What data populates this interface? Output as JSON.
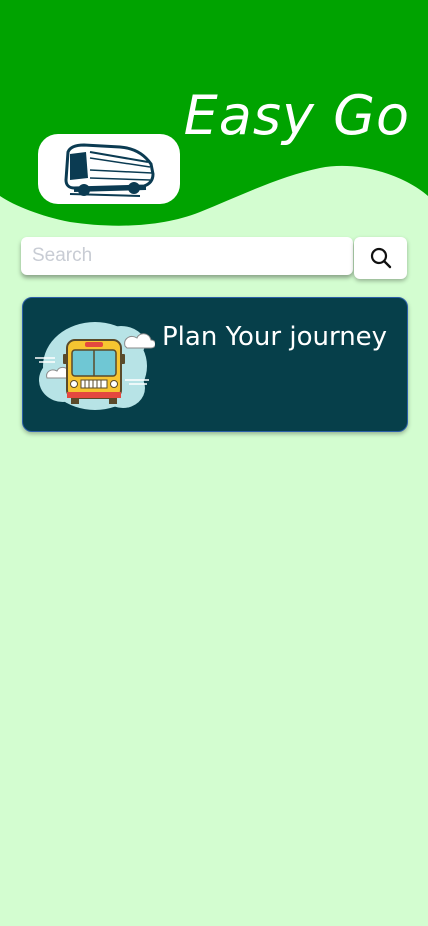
{
  "header": {
    "app_title": "Easy Go",
    "logo_icon": "bus-logo-icon",
    "color_green": "#00a300",
    "color_background": "#d3fdd0"
  },
  "search": {
    "placeholder": "Search",
    "value": "",
    "button_icon": "search-icon"
  },
  "cards": [
    {
      "title": "Plan Your journey",
      "illustration": "bus-clouds-illustration",
      "background": "#063f4a"
    }
  ]
}
